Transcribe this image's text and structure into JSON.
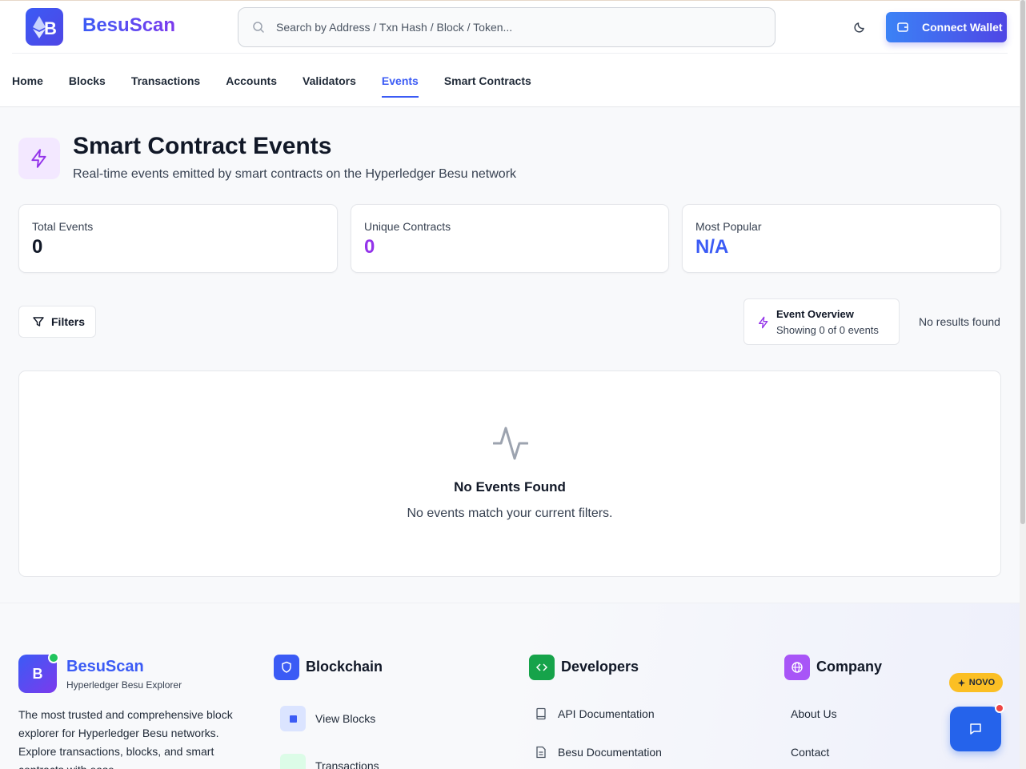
{
  "header": {
    "brand": "BesuScan",
    "search_placeholder": "Search by Address / Txn Hash / Block / Token...",
    "connect_label": "Connect Wallet"
  },
  "nav": {
    "items": [
      {
        "label": "Home"
      },
      {
        "label": "Blocks"
      },
      {
        "label": "Transactions"
      },
      {
        "label": "Accounts"
      },
      {
        "label": "Validators"
      },
      {
        "label": "Events",
        "active": true
      },
      {
        "label": "Smart Contracts"
      }
    ]
  },
  "page": {
    "title": "Smart Contract Events",
    "subtitle": "Real-time events emitted by smart contracts on the Hyperledger Besu network"
  },
  "stats": [
    {
      "label": "Total Events",
      "value": "0",
      "color": "#111827"
    },
    {
      "label": "Unique Contracts",
      "value": "0",
      "color": "#9333ea"
    },
    {
      "label": "Most Popular",
      "value": "N/A",
      "color": "#3b5bf5"
    }
  ],
  "toolbar": {
    "filters_label": "Filters",
    "overview_title": "Event Overview",
    "overview_sub": "Showing 0 of 0 events",
    "results_text": "No results found"
  },
  "empty": {
    "title": "No Events Found",
    "message": "No events match your current filters."
  },
  "footer": {
    "brand": "BesuScan",
    "tagline": "Hyperledger Besu Explorer",
    "description": "The most trusted and comprehensive block explorer for Hyperledger Besu networks. Explore transactions, blocks, and smart contracts with ease.",
    "columns": [
      {
        "title": "Blockchain",
        "links": [
          "View Blocks",
          "Transactions"
        ]
      },
      {
        "title": "Developers",
        "links": [
          "API Documentation",
          "Besu Documentation"
        ]
      },
      {
        "title": "Company",
        "links": [
          "About Us",
          "Contact"
        ]
      }
    ],
    "badge": "NOVO"
  },
  "colors": {
    "accent": "#3b5bf5",
    "purple": "#9333ea",
    "green": "#16a34a"
  }
}
